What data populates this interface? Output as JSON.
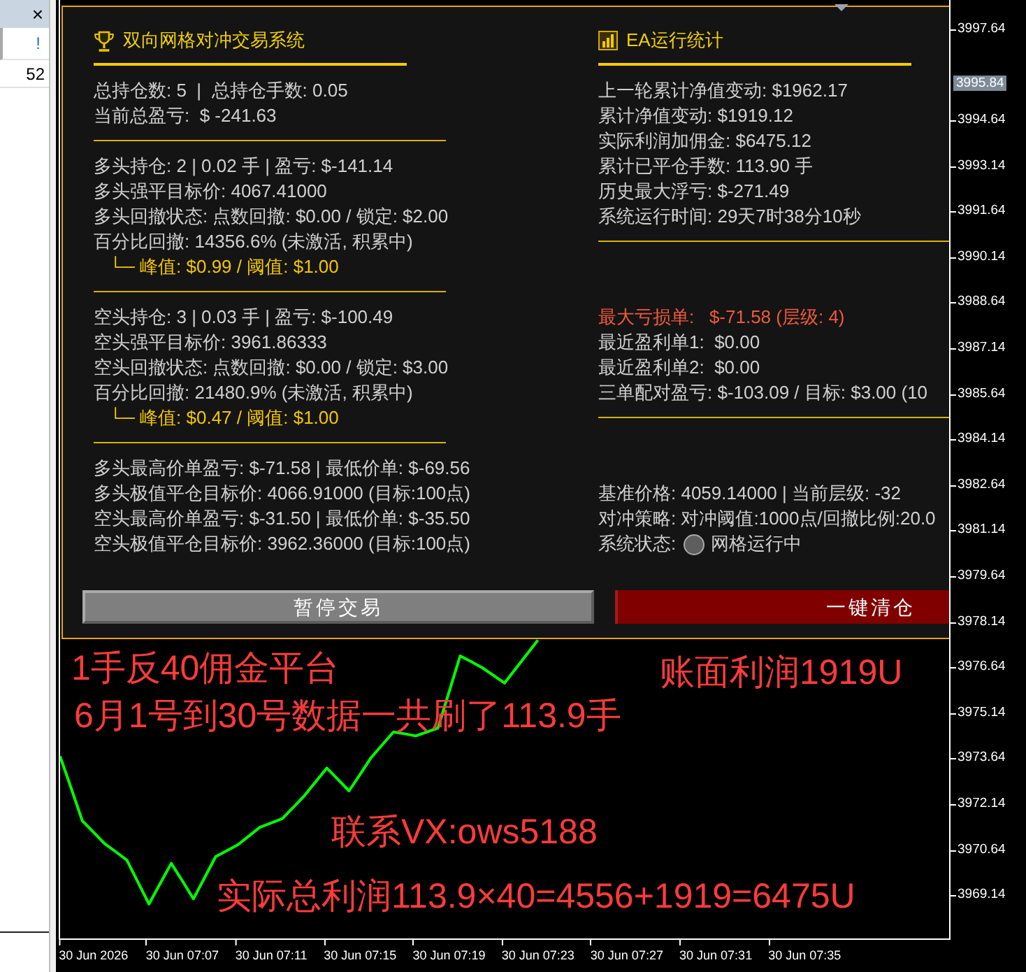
{
  "sidebar": {
    "close": "×",
    "header": "!",
    "rows": [
      "52"
    ]
  },
  "panel": {
    "columns": [
      {
        "kind": "system",
        "title": "双向网格对冲交易系统",
        "sections": [
          {
            "lines": [
              {
                "kind": "normal",
                "text": "总持仓数: 5  |  总持仓手数: 0.05"
              },
              {
                "kind": "normal",
                "text": "当前总盈亏:  $ -241.63"
              }
            ]
          },
          {
            "lines": [
              {
                "kind": "normal",
                "text": "多头持仓: 2 | 0.02 手 | 盈亏: $-141.14"
              },
              {
                "kind": "normal",
                "text": "多头强平目标价: 4067.41000"
              },
              {
                "kind": "normal",
                "text": "多头回撤状态: 点数回撤: $0.00 / 锁定: $2.00"
              },
              {
                "kind": "normal",
                "text": "百分比回撤: 14356.6% (未激活, 积累中)"
              },
              {
                "kind": "highlight",
                "text": "└─ 峰值: $0.99 / 阈值: $1.00"
              }
            ]
          },
          {
            "lines": [
              {
                "kind": "normal",
                "text": "空头持仓: 3 | 0.03 手 | 盈亏: $-100.49"
              },
              {
                "kind": "normal",
                "text": "空头强平目标价: 3961.86333"
              },
              {
                "kind": "normal",
                "text": "空头回撤状态: 点数回撤: $0.00 / 锁定: $3.00"
              },
              {
                "kind": "normal",
                "text": "百分比回撤: 21480.9% (未激活, 积累中)"
              },
              {
                "kind": "highlight",
                "text": "└─ 峰值: $0.47 / 阈值: $1.00"
              }
            ]
          },
          {
            "lines": [
              {
                "kind": "normal",
                "text": "多头最高价单盈亏: $-71.58 | 最低价单: $-69.56"
              },
              {
                "kind": "normal",
                "text": "多头极值平仓目标价: 4066.91000 (目标:100点)"
              },
              {
                "kind": "normal",
                "text": "空头最高价单盈亏: $-31.50 | 最低价单: $-35.50"
              },
              {
                "kind": "normal",
                "text": "空头极值平仓目标价: 3962.36000 (目标:100点)"
              }
            ]
          }
        ]
      },
      {
        "kind": "stats",
        "title": "EA运行统计",
        "sections": [
          {
            "lines": [
              {
                "kind": "normal",
                "text": "上一轮累计净值变动: $1962.17"
              },
              {
                "kind": "normal",
                "text": "累计净值变动: $1919.12"
              },
              {
                "kind": "normal",
                "text": "实际利润加佣金: $6475.12"
              },
              {
                "kind": "normal",
                "text": "累计已平仓手数: 113.90 手"
              },
              {
                "kind": "normal",
                "text": "历史最大浮亏: $-271.49"
              },
              {
                "kind": "normal",
                "text": "系统运行时间: 29天7时38分10秒"
              }
            ]
          },
          {
            "lines": [
              {
                "kind": "alert",
                "text": "最大亏损单:   $-71.58 (层级: 4)"
              },
              {
                "kind": "normal",
                "text": "最近盈利单1:  $0.00"
              },
              {
                "kind": "normal",
                "text": "最近盈利单2:  $0.00"
              },
              {
                "kind": "normal",
                "text": "三单配对盈亏: $-103.09 / 目标: $3.00 (10"
              }
            ]
          },
          {
            "lines": [
              {
                "kind": "normal",
                "text": "基准价格: 4059.14000 | 当前层级: -32"
              },
              {
                "kind": "normal",
                "text": "对冲策略: 对冲阈值:1000点/回撤比例:20.0"
              },
              {
                "kind": "status",
                "label": "系统状态:",
                "value": "网格运行中"
              }
            ]
          }
        ]
      }
    ],
    "buttons": [
      {
        "kind": "pause",
        "label": "暂停交易"
      },
      {
        "kind": "close_all",
        "label": "一键清仓"
      }
    ]
  },
  "chart": {
    "current_price": "3995.84",
    "chart_data": {
      "type": "line",
      "categories": [
        null,
        null,
        null,
        "30 Jun 2026",
        null,
        null,
        null,
        null,
        null,
        null,
        null,
        "30 Jun 07:07",
        null,
        null,
        null,
        null,
        null,
        null,
        null,
        "30 Jun 07:11",
        null,
        null,
        null,
        null,
        null,
        null,
        null,
        "30 Jun 07:15",
        null,
        null,
        null,
        null,
        null,
        null,
        null,
        "30 Jun 07:19",
        null,
        null,
        null,
        null,
        null,
        null,
        null,
        "30 Jun 07:23",
        null,
        null,
        null,
        null,
        null,
        null,
        null,
        "30 Jun 07:27",
        null,
        null,
        null,
        null,
        null,
        null,
        null,
        "30 Jun 07:31",
        null,
        null,
        null,
        null,
        null,
        null,
        null,
        "30 Jun 07:35",
        null,
        null,
        null,
        null,
        null,
        null,
        null,
        null,
        null,
        null,
        null,
        null,
        null
      ],
      "series": [
        {
          "color": "#00ff00",
          "values": [
            3973.72,
            3972.66,
            3971.6,
            3971.23,
            3970.85,
            3970.58,
            3970.31,
            3969.59,
            3968.86,
            3969.53,
            3970.2,
            3969.62,
            3969.03,
            3969.73,
            3970.42,
            3970.62,
            3970.81,
            3971.1,
            3971.39,
            3971.53,
            3971.67,
            3972.05,
            3972.43,
            3972.88,
            3973.33,
            3972.96,
            3972.58,
            3973.13,
            3973.68,
            3974.1,
            3974.52,
            3974.46,
            3974.39,
            3974.52,
            3974.65,
            3975.84,
            3977.02,
            3976.83,
            3976.63,
            3976.38,
            3976.13,
            3976.6,
            3977.07,
            3977.54,
            null,
            null,
            null,
            null,
            null,
            null,
            null,
            null,
            null,
            null,
            null,
            null,
            null,
            null,
            null,
            null,
            null,
            null,
            null,
            null,
            null,
            null,
            null,
            null,
            null,
            null,
            null,
            null,
            null,
            null,
            null,
            null,
            null,
            null,
            null,
            null,
            null
          ]
        }
      ],
      "ylim": [
        3967.73,
        3998.59
      ],
      "yticks": [
        3997.64,
        3994.64,
        3993.14,
        3991.64,
        3990.14,
        3988.64,
        3987.14,
        3985.64,
        3984.14,
        3982.64,
        3981.14,
        3979.64,
        3978.14,
        3976.64,
        3975.14,
        3973.64,
        3972.14,
        3970.64,
        3969.14
      ]
    }
  },
  "annotations": [
    {
      "text": "1手反40佣金平台"
    },
    {
      "text": "6月1号到30号数据一共刷了113.9手"
    },
    {
      "text": "账面利润1919U"
    },
    {
      "text": "联系VX:ows5188"
    },
    {
      "text": "实际总利润113.9×40=4556+1919=6475U"
    }
  ]
}
